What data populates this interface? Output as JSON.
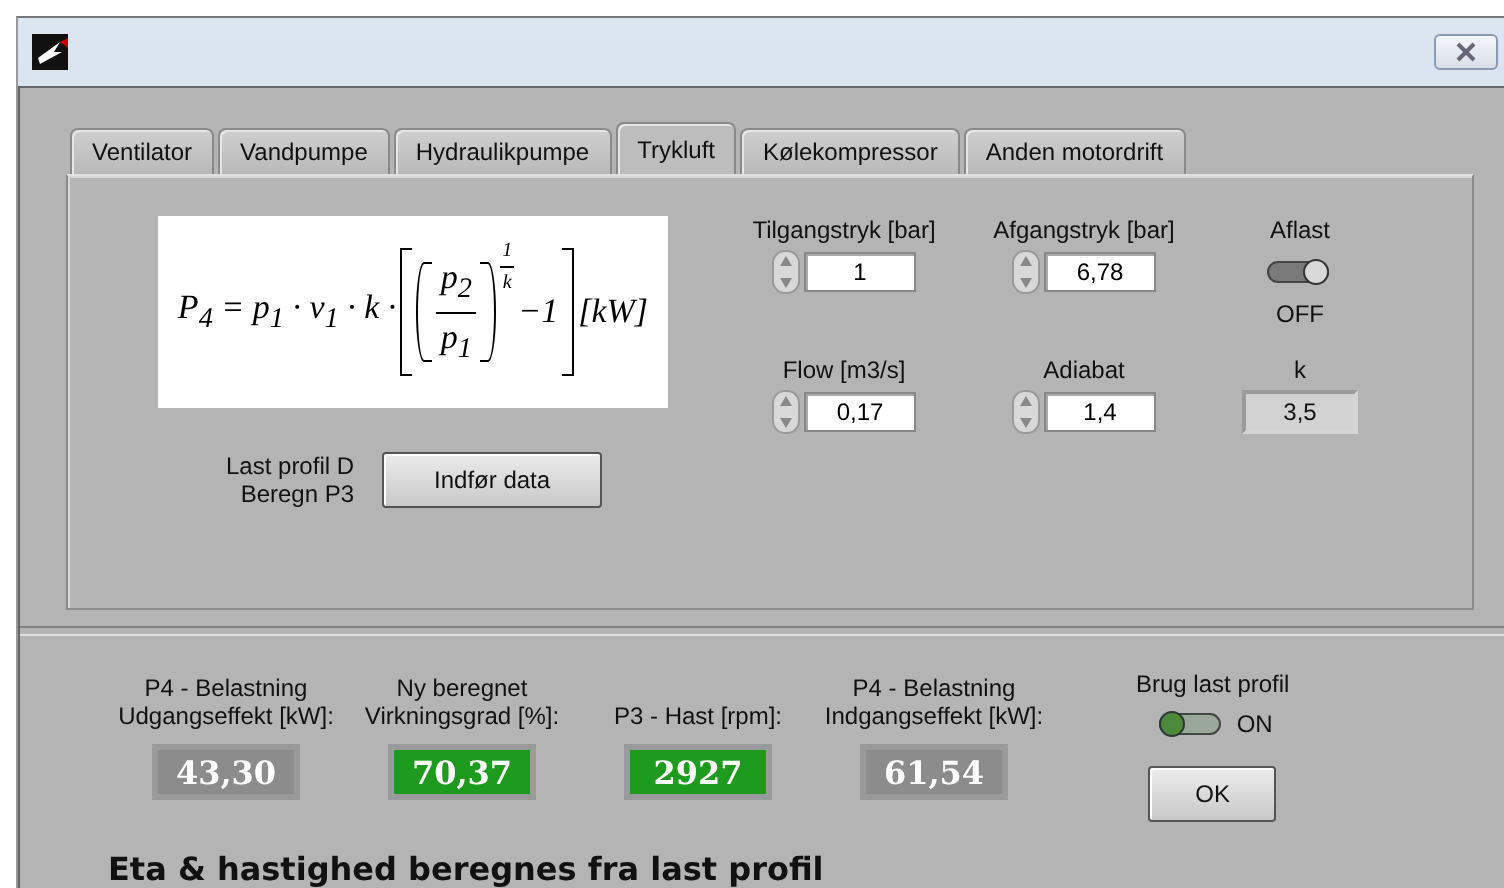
{
  "tabs": [
    {
      "label": "Ventilator",
      "selected": false
    },
    {
      "label": "Vandpumpe",
      "selected": false
    },
    {
      "label": "Hydraulikpumpe",
      "selected": false
    },
    {
      "label": "Trykluft",
      "selected": true
    },
    {
      "label": "Kølekompressor",
      "selected": false
    },
    {
      "label": "Anden motordrift",
      "selected": false
    }
  ],
  "formula": {
    "left": "P$_{4}$ = p$_{1}$ · v$_{1}$ · k ·",
    "numerator": "p$_{2}$",
    "denominator": "p$_{1}$",
    "exponent_numerator": "1",
    "exponent_denominator": "k",
    "minus": "−1",
    "unit": "[kW]"
  },
  "load_profile": {
    "lines": [
      "Last profil D",
      "Beregn P3"
    ],
    "button": "Indfør data"
  },
  "inputs": [
    {
      "kind": "spinner",
      "label": "Tilgangstryk [bar]",
      "value": "1"
    },
    {
      "kind": "spinner",
      "label": "Afgangstryk [bar]",
      "value": "6,78"
    },
    {
      "kind": "toggle",
      "label": "Aflast",
      "on": false,
      "state_label": "OFF"
    },
    {
      "kind": "spinner",
      "label": "Flow [m3/s]",
      "value": "0,17"
    },
    {
      "kind": "spinner",
      "label": "Adiabat",
      "value": "1,4"
    },
    {
      "kind": "indicator",
      "label": "k",
      "value": "3,5"
    }
  ],
  "results": [
    {
      "lines": [
        "P4 - Belastning",
        "Udgangseffekt [kW]:"
      ],
      "value": "43,30",
      "color": "#8c8c8c"
    },
    {
      "lines": [
        "Ny beregnet",
        "Virkningsgrad [%]:"
      ],
      "value": "70,37",
      "color": "#1e9a1e"
    },
    {
      "lines": [
        "P3 - Hast [rpm]:"
      ],
      "value": "2927",
      "color": "#1e9a1e"
    },
    {
      "lines": [
        "P4 - Belastning",
        "Indgangseffekt [kW]:"
      ],
      "value": "61,54",
      "color": "#8c8c8c"
    }
  ],
  "profile_toggle": {
    "label": "Brug last profil",
    "on": true,
    "state_label": "ON"
  },
  "ok_button": "OK",
  "footer": "Eta & hastighed beregnes fra last profil"
}
